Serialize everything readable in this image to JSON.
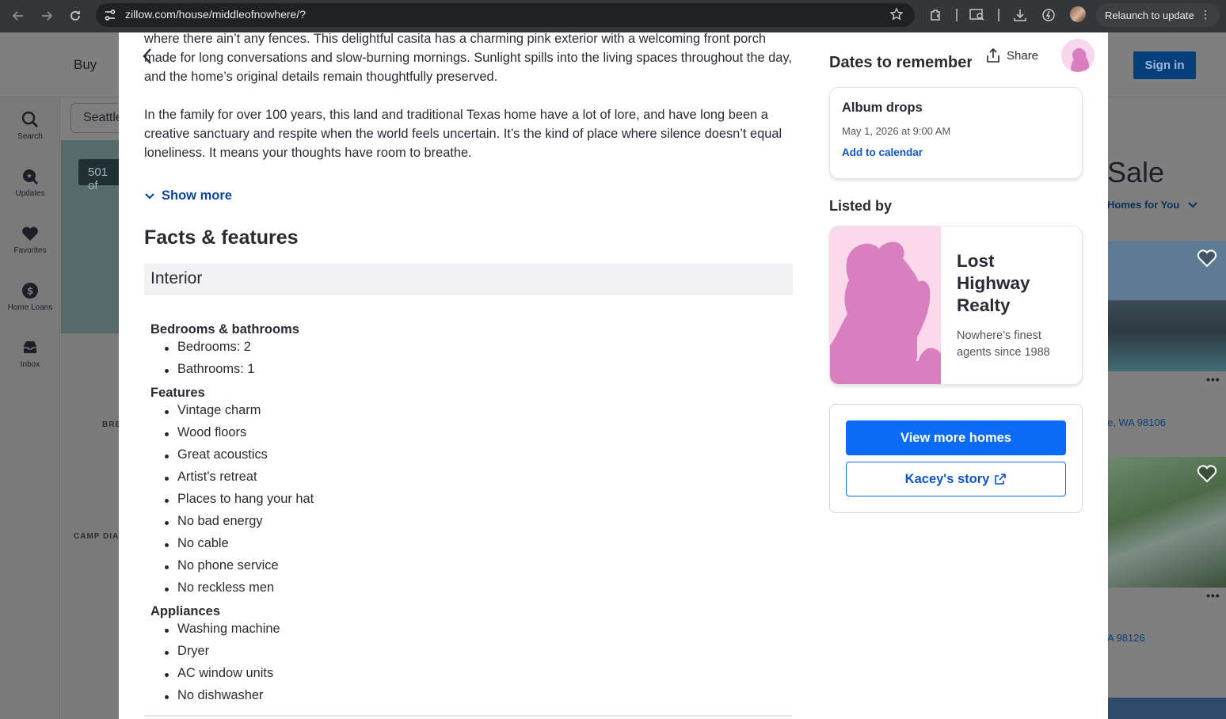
{
  "browser": {
    "url": "zillow.com/house/middleofnowhere/?",
    "relaunch_label": "Relaunch to update",
    "menu_dots": "⋮"
  },
  "background": {
    "nav_buy": "Buy",
    "sign_in": "Sign in",
    "rail": [
      {
        "label": "Search",
        "icon": "search-icon"
      },
      {
        "label": "Updates",
        "icon": "updates-icon"
      },
      {
        "label": "Favorites",
        "icon": "heart-icon"
      },
      {
        "label": "Home Loans",
        "icon": "dollar-icon"
      },
      {
        "label": "Inbox",
        "icon": "inbox-icon"
      }
    ],
    "search_value": "Seattle",
    "result_count": "501 of",
    "map_labels": [
      "BRE",
      "CAMP DIA"
    ],
    "right_title": "Sale",
    "right_sub": "Homes for You",
    "addresses": [
      "e, WA 98106",
      "A 98126"
    ],
    "more_dots": "•••"
  },
  "modal": {
    "description": [
      "where there ain’t any fences. This delightful casita has a charming pink exterior with a welcoming front porch made for long conversations and slow-burning mornings. Sunlight spills into the living spaces throughout the day, and the home’s original details remain thoughtfully preserved.",
      "In the family for over 100 years, this land and traditional Texas home have a lot of lore, and have long been a creative sanctuary and respite when the world feels uncertain. It’s the kind of place where silence doesn’t equal loneliness. It means your thoughts have room to breathe."
    ],
    "show_more": "Show more",
    "facts_heading": "Facts & features",
    "interior_heading": "Interior",
    "sections": [
      {
        "title": "Bedrooms & bathrooms",
        "items": [
          "Bedrooms: 2",
          "Bathrooms: 1"
        ]
      },
      {
        "title": "Features",
        "items": [
          "Vintage charm",
          "Wood floors",
          "Great acoustics",
          "Artist's retreat",
          "Places to hang your hat",
          "No bad energy",
          "No cable",
          "No phone service",
          "No reckless men"
        ]
      },
      {
        "title": "Appliances",
        "items": [
          "Washing machine",
          "Dryer",
          "AC window units",
          "No dishwasher"
        ]
      }
    ],
    "dates_heading": "Dates to remember",
    "share_label": "Share",
    "event": {
      "title": "Album drops",
      "date": "May 1, 2026 at 9:00 AM",
      "link": "Add to calendar"
    },
    "listed_by_heading": "Listed by",
    "agent": {
      "name": "Lost Highway Realty",
      "tagline": "Nowhere’s finest agents since 1988"
    },
    "cta": {
      "primary": "View more homes",
      "secondary": "Kacey's story"
    }
  },
  "colors": {
    "accent_blue": "#0b6bf5",
    "link_blue": "#0d55c8",
    "silhouette_pink": "#d97fc0",
    "avatar_bg_pink": "#fbd8ea"
  }
}
